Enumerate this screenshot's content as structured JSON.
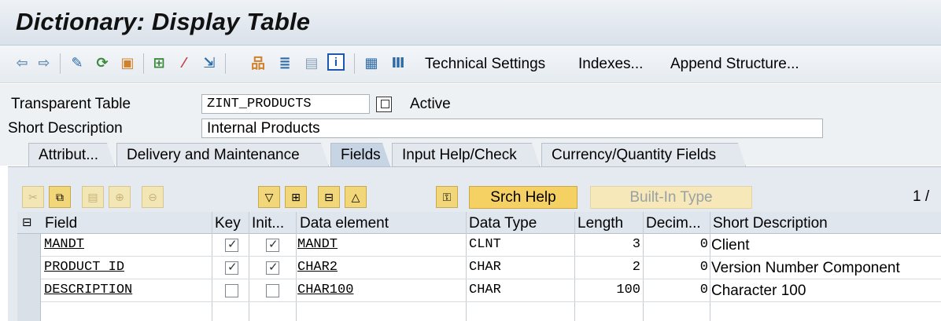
{
  "window": {
    "title": "Dictionary: Display Table"
  },
  "toolbar": {
    "icons": [
      "back-arrow-icon",
      "forward-arrow-icon",
      "other-object-icon",
      "display-change-icon",
      "activate-icon",
      "where-used-icon",
      "magic-wand-icon",
      "navigate-icon",
      "hierarchy-icon",
      "layout-icon",
      "list-icon",
      "info-icon",
      "tree-icon",
      "columns-icon"
    ],
    "technical_settings": "Technical Settings",
    "indexes": "Indexes...",
    "append_structure": "Append Structure..."
  },
  "header": {
    "table_label": "Transparent Table",
    "table_value": "ZINT_PRODUCTS",
    "status": "Active",
    "desc_label": "Short Description",
    "desc_value": "Internal Products"
  },
  "tabs": [
    {
      "label": "Attribut..."
    },
    {
      "label": "Delivery and Maintenance"
    },
    {
      "label": "Fields",
      "active": true
    },
    {
      "label": "Input Help/Check"
    },
    {
      "label": "Currency/Quantity Fields"
    }
  ],
  "table_toolbar": {
    "srch_help": "Srch Help",
    "builtin_type": "Built-In Type",
    "page": "1 /"
  },
  "columns": [
    "Field",
    "Key",
    "Init...",
    "Data element",
    "Data Type",
    "Length",
    "Decim...",
    "Short Description"
  ],
  "rows": [
    {
      "field": "MANDT",
      "key": true,
      "init": true,
      "data_element": "MANDT",
      "data_type": "CLNT",
      "length": "3",
      "decimals": "0",
      "short_desc": "Client"
    },
    {
      "field": "PRODUCT_ID",
      "key": true,
      "init": true,
      "data_element": "CHAR2",
      "data_type": "CHAR",
      "length": "2",
      "decimals": "0",
      "short_desc": "Version Number Component"
    },
    {
      "field": "DESCRIPTION",
      "key": false,
      "init": false,
      "data_element": "CHAR100",
      "data_type": "CHAR",
      "length": "100",
      "decimals": "0",
      "short_desc": "Character 100"
    }
  ]
}
